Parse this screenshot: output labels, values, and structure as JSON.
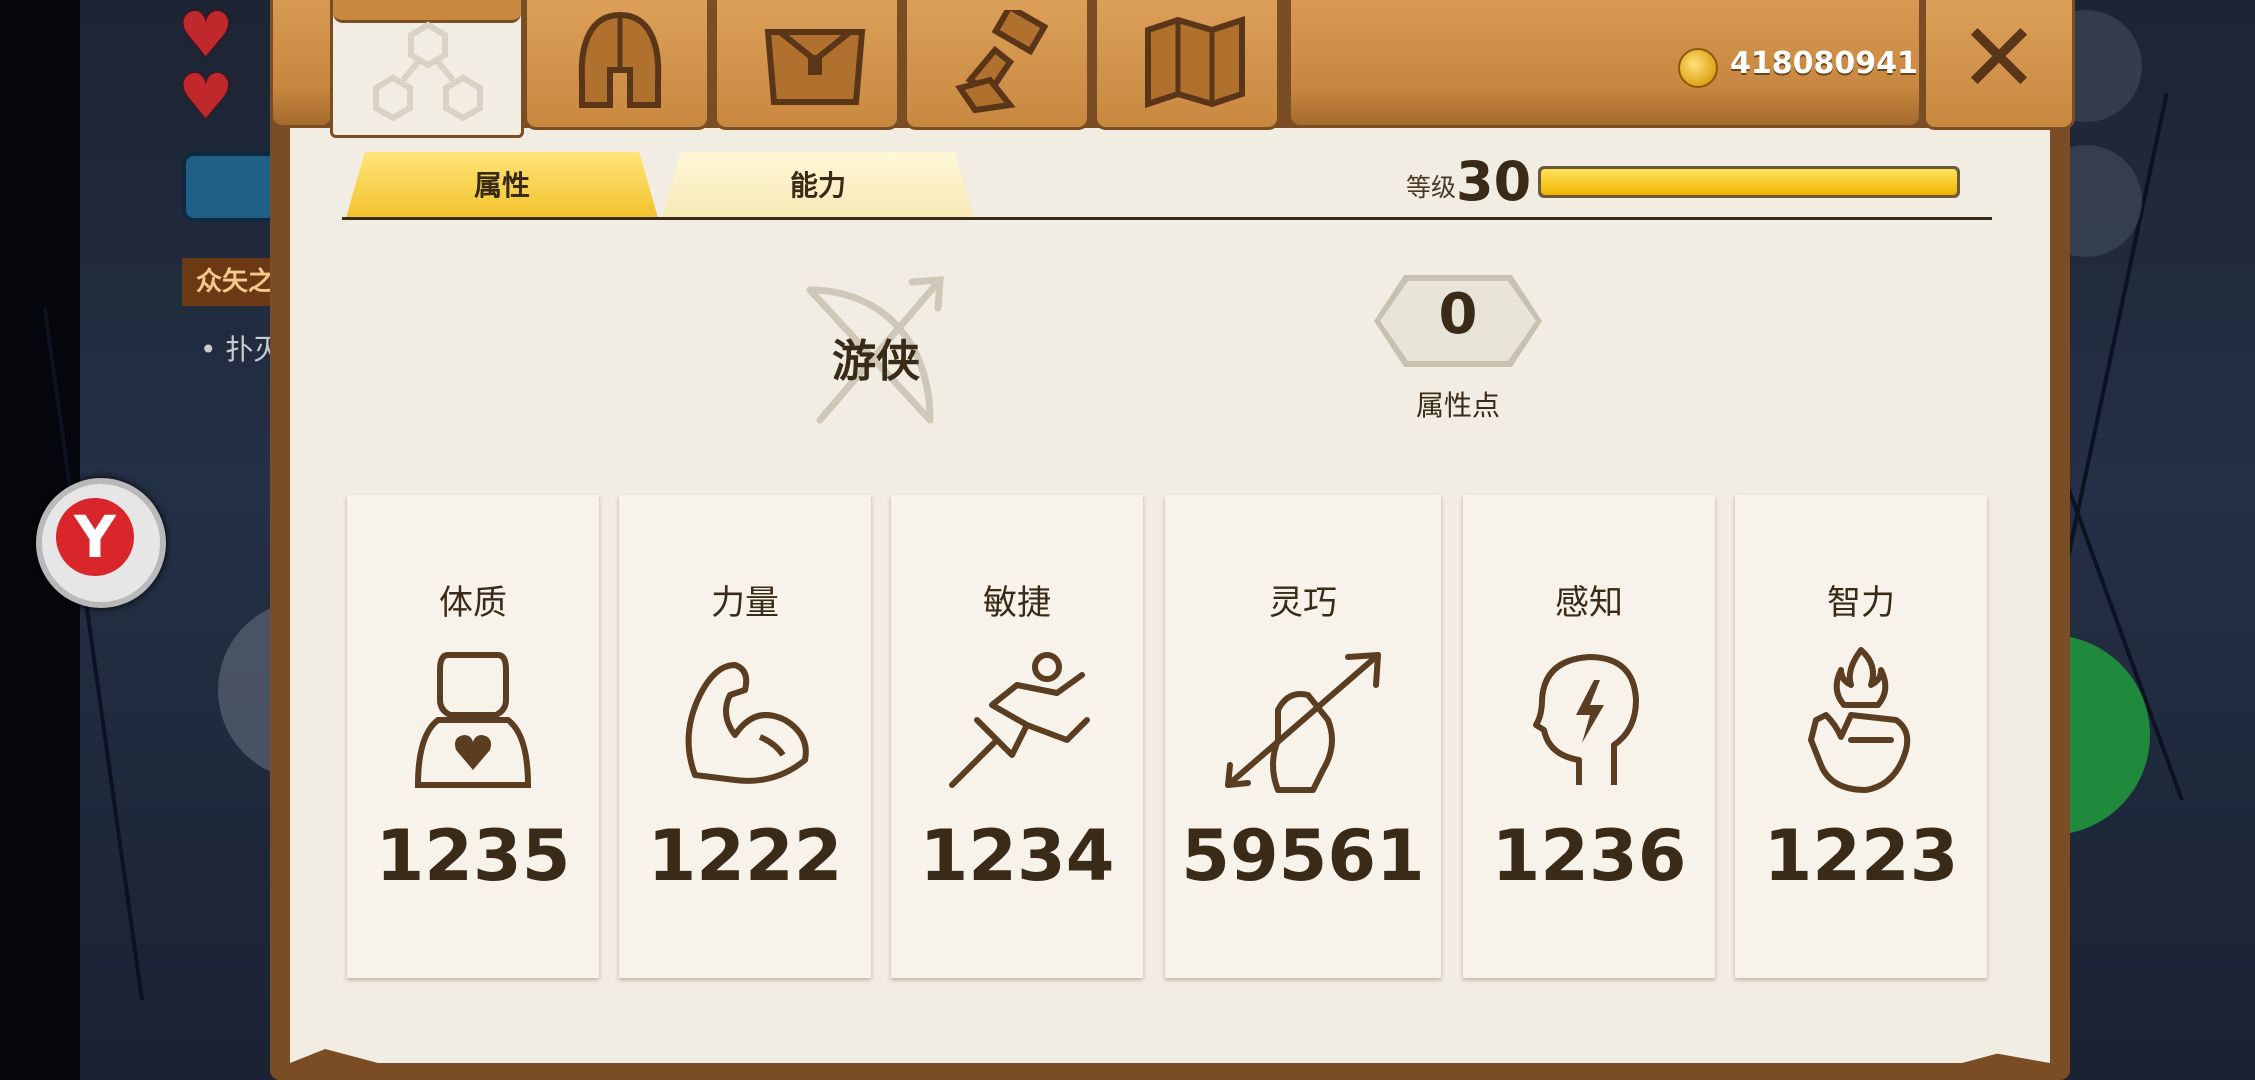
{
  "header": {
    "tabs": [
      {
        "name": "character",
        "icon": "hexagon-nodes-icon",
        "active": true
      },
      {
        "name": "equipment",
        "icon": "helmet-icon",
        "active": false
      },
      {
        "name": "inventory",
        "icon": "bag-icon",
        "active": false
      },
      {
        "name": "crafting",
        "icon": "hammer-icon",
        "active": false
      },
      {
        "name": "map",
        "icon": "map-icon",
        "active": false
      }
    ],
    "gold": "418080941",
    "close_icon": "close-icon"
  },
  "subtabs": {
    "attributes": "属性",
    "abilities": "能力"
  },
  "level": {
    "label": "等级",
    "value": "30",
    "progress": 1.0
  },
  "character": {
    "class_name": "游侠",
    "class_icon": "bow-icon",
    "points_value": "0",
    "points_label": "属性点"
  },
  "stats": [
    {
      "label": "体质",
      "value": "1235",
      "icon": "body-heart-icon"
    },
    {
      "label": "力量",
      "value": "1222",
      "icon": "flexed-arm-icon"
    },
    {
      "label": "敏捷",
      "value": "1234",
      "icon": "running-figure-icon"
    },
    {
      "label": "灵巧",
      "value": "59561",
      "icon": "hand-arrow-icon"
    },
    {
      "label": "感知",
      "value": "1236",
      "icon": "head-lightning-icon"
    },
    {
      "label": "智力",
      "value": "1223",
      "icon": "hand-flame-icon"
    }
  ],
  "background": {
    "quest_tag": "众矢之",
    "quest_line": "• 扑灭"
  },
  "colors": {
    "wood": "#c8883f",
    "paper": "#f1ede2",
    "accent_yellow": "#f2c22b",
    "text_dark": "#3a2a18",
    "gold_text": "#ffffff"
  }
}
